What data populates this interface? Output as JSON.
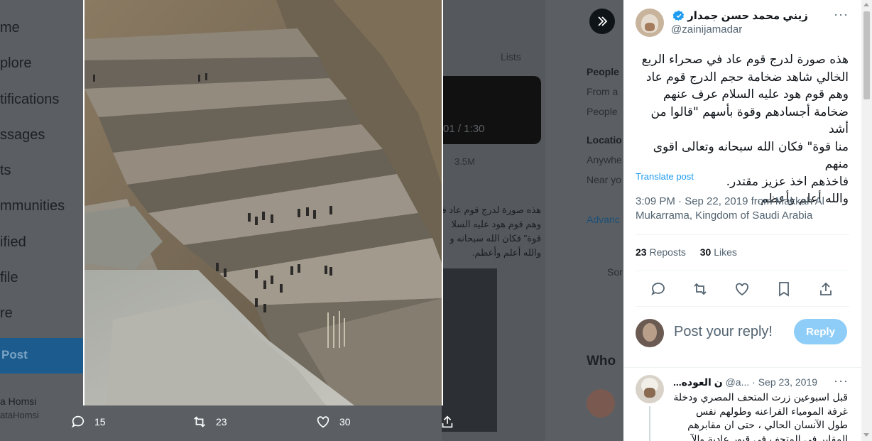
{
  "background": {
    "nav_items": [
      "me",
      "plore",
      "tifications",
      "ssages",
      "ts",
      "mmunities",
      "ified",
      "file",
      "re"
    ],
    "post_button_label": "Post",
    "user_name": "a Homsi",
    "user_handle": "ataHomsi",
    "lists_label": "Lists",
    "video_time": "01 / 1:30",
    "views": "3.5M",
    "tweet_preview_lines": [
      "هذه صورة لدرج قوم عاد في",
      "وهم قوم هود عليه السلا",
      "قوة\" فكان الله سبحانه و",
      "والله أعلم وأعظم."
    ],
    "right_col": {
      "people_head": "People",
      "people_1": "From a",
      "people_2": "People",
      "location_head": "Locatio",
      "location_1": "Anywhe",
      "location_2": "Near yo",
      "advanced": "Advanc",
      "sor": "Sor",
      "who": "Who"
    }
  },
  "action_bar": {
    "replies": "15",
    "reposts": "23",
    "likes": "30"
  },
  "tweet": {
    "author_name": "زيني محمد حسن جمدار",
    "author_handle": "@zainijamadar",
    "text": "هذه صورة لدرج قوم عاد في صحراء الربع\nالخالي شاهد ضخامة حجم الدرج قوم عاد\nوهم قوم هود عليه السلام عرف عنهم\nضخامة أجسادهم وقوة بأسهم \"قالوا من أشد\nمنا قوة\" فكان الله سبحانه وتعالى اقوى منهم\nفاخذهم اخذ عزيز مقتدر.\nوالله أعلم وأعظم.",
    "translate_label": "Translate post",
    "meta": "3:09 PM · Sep 22, 2019 from Makkah Al Mukarrama, Kingdom of Saudi Arabia",
    "reposts_count": "23",
    "reposts_label": "Reposts",
    "likes_count": "30",
    "likes_label": "Likes"
  },
  "reply_box": {
    "placeholder": "Post your reply!",
    "button_label": "Reply"
  },
  "comment": {
    "name": "...ن العوده",
    "handle": "@a...",
    "date": "· Sep 23, 2019",
    "text": "قبل اسبوعين زرت المتحف المصري ودخلة\nغرفة المومياء الفراعنه وطولهم نفس\nطول الآنسان الحالي ، حتى ان مقابرهم\nالمقابر في المتحف في قبور عادية والآ"
  },
  "colors": {
    "accent": "#1d9bf0",
    "reply_button": "#8ecdf8",
    "overlay": "#5b5f63"
  }
}
